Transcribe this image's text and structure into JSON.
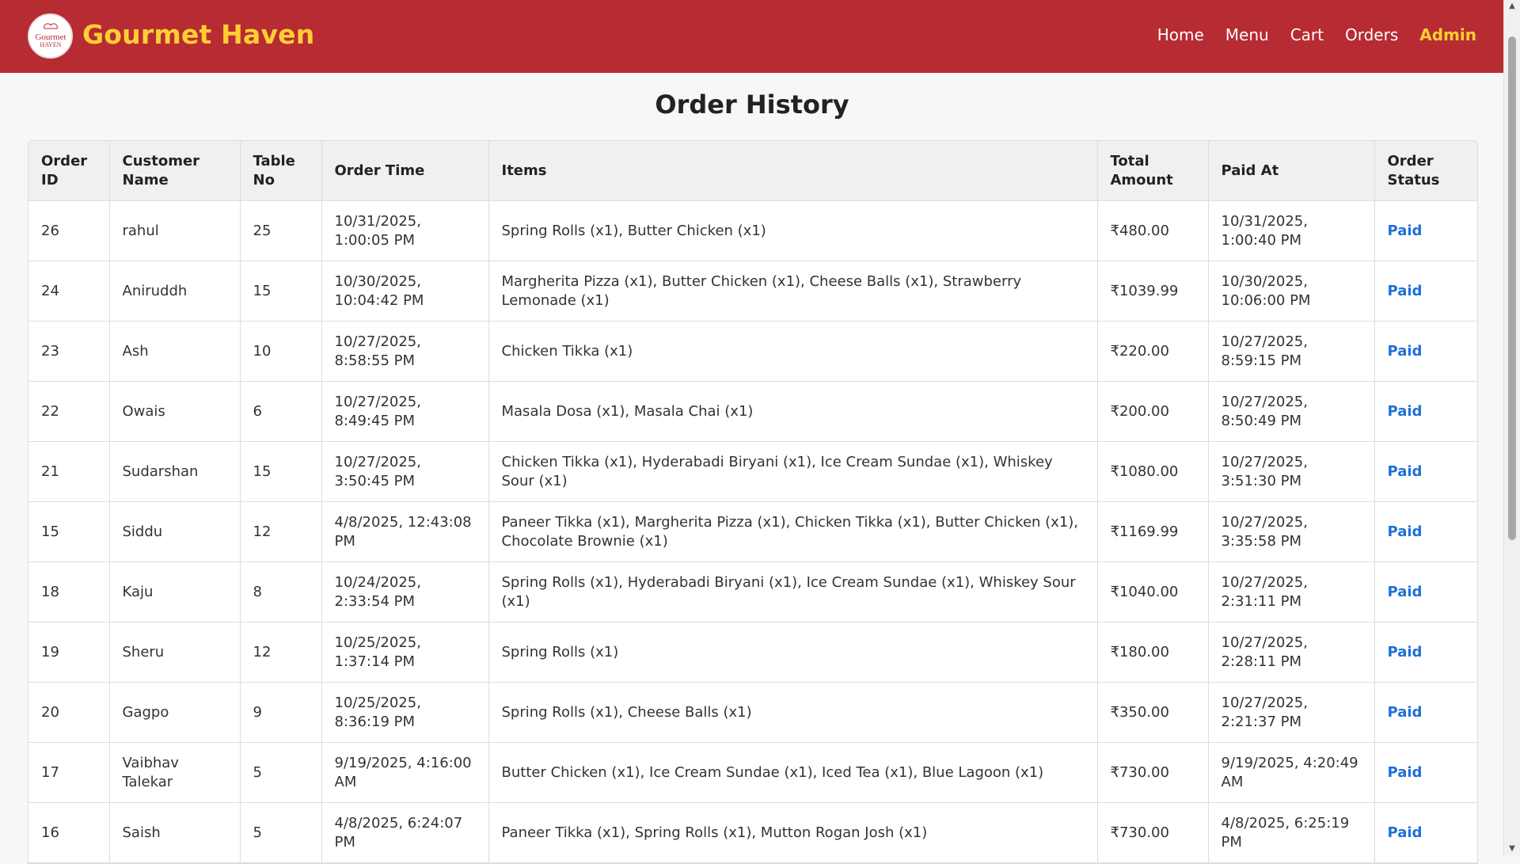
{
  "brand": {
    "name": "Gourmet Haven",
    "logo_text_1": "Gourmet",
    "logo_text_2": "HAVEN"
  },
  "nav": {
    "items": [
      {
        "label": "Home",
        "active": false
      },
      {
        "label": "Menu",
        "active": false
      },
      {
        "label": "Cart",
        "active": false
      },
      {
        "label": "Orders",
        "active": false
      },
      {
        "label": "Admin",
        "active": true
      }
    ]
  },
  "page": {
    "title": "Order History"
  },
  "table": {
    "headers": [
      "Order ID",
      "Customer Name",
      "Table No",
      "Order Time",
      "Items",
      "Total Amount",
      "Paid At",
      "Order Status"
    ],
    "rows": [
      [
        "26",
        "rahul",
        "25",
        "10/31/2025, 1:00:05 PM",
        "Spring Rolls (x1), Butter Chicken (x1)",
        "₹480.00",
        "10/31/2025, 1:00:40 PM",
        "Paid"
      ],
      [
        "24",
        "Aniruddh",
        "15",
        "10/30/2025, 10:04:42 PM",
        "Margherita Pizza (x1), Butter Chicken (x1), Cheese Balls (x1), Strawberry Lemonade (x1)",
        "₹1039.99",
        "10/30/2025, 10:06:00 PM",
        "Paid"
      ],
      [
        "23",
        "Ash",
        "10",
        "10/27/2025, 8:58:55 PM",
        "Chicken Tikka (x1)",
        "₹220.00",
        "10/27/2025, 8:59:15 PM",
        "Paid"
      ],
      [
        "22",
        "Owais",
        "6",
        "10/27/2025, 8:49:45 PM",
        "Masala Dosa (x1), Masala Chai (x1)",
        "₹200.00",
        "10/27/2025, 8:50:49 PM",
        "Paid"
      ],
      [
        "21",
        "Sudarshan",
        "15",
        "10/27/2025, 3:50:45 PM",
        "Chicken Tikka (x1), Hyderabadi Biryani (x1), Ice Cream Sundae (x1), Whiskey Sour (x1)",
        "₹1080.00",
        "10/27/2025, 3:51:30 PM",
        "Paid"
      ],
      [
        "15",
        "Siddu",
        "12",
        "4/8/2025, 12:43:08 PM",
        "Paneer Tikka (x1), Margherita Pizza (x1), Chicken Tikka (x1), Butter Chicken (x1), Chocolate Brownie (x1)",
        "₹1169.99",
        "10/27/2025, 3:35:58 PM",
        "Paid"
      ],
      [
        "18",
        "Kaju",
        "8",
        "10/24/2025, 2:33:54 PM",
        "Spring Rolls (x1), Hyderabadi Biryani (x1), Ice Cream Sundae (x1), Whiskey Sour (x1)",
        "₹1040.00",
        "10/27/2025, 2:31:11 PM",
        "Paid"
      ],
      [
        "19",
        "Sheru",
        "12",
        "10/25/2025, 1:37:14 PM",
        "Spring Rolls (x1)",
        "₹180.00",
        "10/27/2025, 2:28:11 PM",
        "Paid"
      ],
      [
        "20",
        "Gagpo",
        "9",
        "10/25/2025, 8:36:19 PM",
        "Spring Rolls (x1), Cheese Balls (x1)",
        "₹350.00",
        "10/27/2025, 2:21:37 PM",
        "Paid"
      ],
      [
        "17",
        "Vaibhav Talekar",
        "5",
        "9/19/2025, 4:16:00 AM",
        "Butter Chicken (x1), Ice Cream Sundae (x1), Iced Tea (x1), Blue Lagoon (x1)",
        "₹730.00",
        "9/19/2025, 4:20:49 AM",
        "Paid"
      ],
      [
        "16",
        "Saish",
        "5",
        "4/8/2025, 6:24:07 PM",
        "Paneer Tikka (x1), Spring Rolls (x1), Mutton Rogan Josh (x1)",
        "₹730.00",
        "4/8/2025, 6:25:19 PM",
        "Paid"
      ]
    ]
  },
  "colors": {
    "navbar_bg": "#b72b32",
    "brand_accent": "#ffce35",
    "status_blue": "#1e6fd9"
  },
  "icons": {
    "logo": "chef-hat-logo-icon",
    "scroll_up": "arrow-up-icon",
    "scroll_down": "arrow-down-icon"
  }
}
